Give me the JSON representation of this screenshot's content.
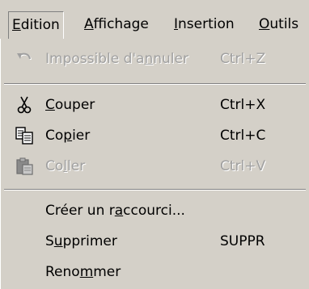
{
  "menubar": {
    "items": [
      {
        "pre": "",
        "mnemonic": "E",
        "post": "dition"
      },
      {
        "pre": "",
        "mnemonic": "A",
        "post": "ffichage"
      },
      {
        "pre": "",
        "mnemonic": "I",
        "post": "nsertion"
      },
      {
        "pre": "",
        "mnemonic": "O",
        "post": "utils"
      }
    ],
    "active_index": 0
  },
  "edit_menu": {
    "undo": {
      "pre": "Impossible d'a",
      "mnemonic": "n",
      "post": "nuler",
      "shortcut": "Ctrl+Z",
      "icon": "undo-icon",
      "enabled": false
    },
    "cut": {
      "pre": "",
      "mnemonic": "C",
      "post": "ouper",
      "shortcut": "Ctrl+X",
      "icon": "scissors-icon",
      "enabled": true
    },
    "copy": {
      "pre": "Co",
      "mnemonic": "p",
      "post": "ier",
      "shortcut": "Ctrl+C",
      "icon": "copy-icon",
      "enabled": true
    },
    "paste": {
      "pre": "Co",
      "mnemonic": "l",
      "post": "ler",
      "shortcut": "Ctrl+V",
      "icon": "paste-icon",
      "enabled": false
    },
    "create_shortcut": {
      "pre": "Créer un r",
      "mnemonic": "a",
      "post": "ccourci...",
      "shortcut": "",
      "enabled": true
    },
    "delete": {
      "pre": "S",
      "mnemonic": "u",
      "post": "pprimer",
      "shortcut": "SUPPR",
      "enabled": true
    },
    "rename": {
      "pre": "Reno",
      "mnemonic": "m",
      "post": "mer",
      "shortcut": "",
      "enabled": true
    }
  },
  "colors": {
    "face": "#d4d0c8",
    "shadow": "#808080",
    "highlight": "#ffffff",
    "disabled_text": "#a0a0a0"
  }
}
